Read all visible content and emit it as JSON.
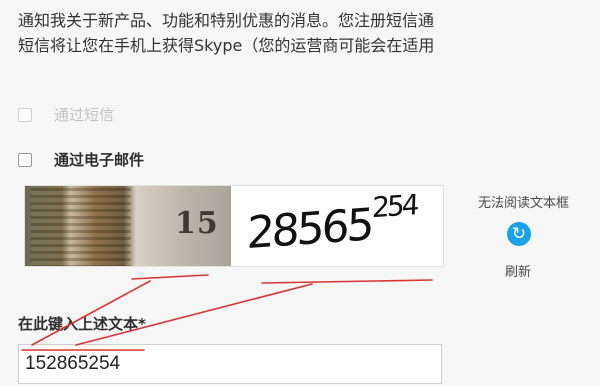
{
  "intro": {
    "line1": "通知我关于新产品、功能和特别优惠的消息。您注册短信通",
    "line2": "短信将让您在手机上获得Skype（您的运营商可能会在适用"
  },
  "options": {
    "sms_label": "通过短信",
    "email_label": "通过电子邮件"
  },
  "captcha": {
    "photo_number": "15",
    "code_main": "28565",
    "code_sup": "254",
    "unreadable_text": "无法阅读文本框",
    "refresh_icon": "refresh-icon",
    "refresh_label": "刷新"
  },
  "input": {
    "label": "在此键入上述文本*",
    "value": "152865254"
  },
  "colors": {
    "annotation": "#d93434",
    "refresh": "#1aa3e8"
  }
}
